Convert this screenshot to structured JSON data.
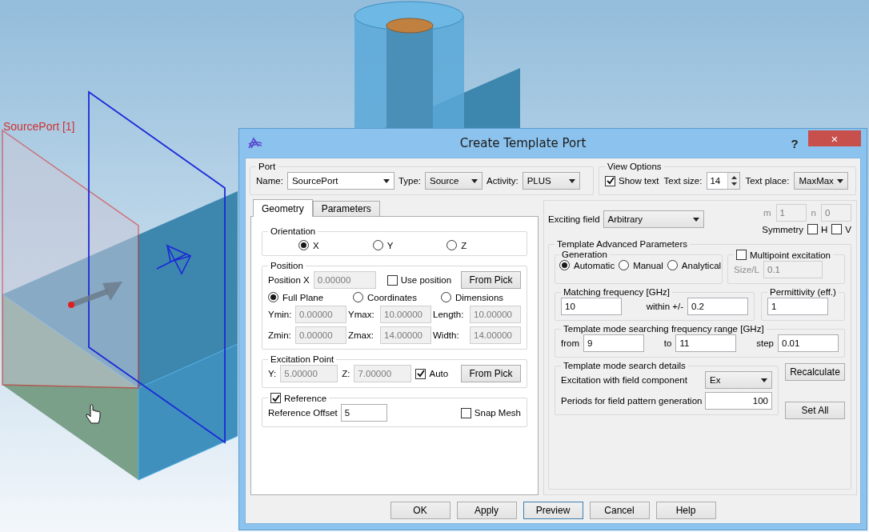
{
  "scene": {
    "port_label": "SourcePort [1]"
  },
  "dialog": {
    "title": "Create Template Port",
    "help": "?",
    "close": "×"
  },
  "port": {
    "title": "Port",
    "name_label": "Name:",
    "name": "SourcePort",
    "type_label": "Type:",
    "type": "Source",
    "activity_label": "Activity:",
    "activity": "PLUS"
  },
  "view_options": {
    "title": "View Options",
    "show_text": {
      "label": "Show text",
      "checked": true
    },
    "text_size_label": "Text size:",
    "text_size": "14",
    "text_place_label": "Text place:",
    "text_place": "MaxMax"
  },
  "tabs": [
    {
      "label": "Geometry",
      "selected": true
    },
    {
      "label": "Parameters",
      "selected": false
    }
  ],
  "orientation": {
    "title": "Orientation",
    "options": [
      {
        "label": "X",
        "selected": true
      },
      {
        "label": "Y",
        "selected": false
      },
      {
        "label": "Z",
        "selected": false
      }
    ]
  },
  "position": {
    "title": "Position",
    "position_x_label": "Position X",
    "position_x": {
      "value": "0.00000",
      "disabled": true
    },
    "use_position": {
      "label": "Use position",
      "checked": false
    },
    "from_pick": "From Pick",
    "modes": [
      {
        "label": "Full Plane",
        "selected": true
      },
      {
        "label": "Coordinates",
        "selected": false
      },
      {
        "label": "Dimensions",
        "selected": false
      }
    ],
    "fields": [
      {
        "label": "Ymin:",
        "value": "0.00000",
        "disabled": true
      },
      {
        "label": "Ymax:",
        "value": "10.00000",
        "disabled": true
      },
      {
        "label": "Length:",
        "value": "10.00000",
        "disabled": true
      },
      {
        "label": "Zmin:",
        "value": "0.00000",
        "disabled": true
      },
      {
        "label": "Zmax:",
        "value": "14.00000",
        "disabled": true
      },
      {
        "label": "Width:",
        "value": "14.00000",
        "disabled": true
      }
    ]
  },
  "excitation_point": {
    "title": "Excitation Point",
    "fields": [
      {
        "label": "Y:",
        "value": "5.00000",
        "disabled": true
      },
      {
        "label": "Z:",
        "value": "7.00000",
        "disabled": true
      }
    ],
    "auto": {
      "label": "Auto",
      "checked": true
    },
    "from_pick": "From Pick"
  },
  "reference": {
    "label": "Reference",
    "checked": true,
    "offset_label": "Reference Offset",
    "offset": {
      "value": "5",
      "disabled": false
    },
    "snap_mesh": {
      "label": "Snap Mesh",
      "checked": false
    }
  },
  "exciting_field": {
    "label": "Exciting field",
    "value": "Arbitrary",
    "m_label": "m",
    "m": {
      "value": "1",
      "disabled": true
    },
    "n_label": "n",
    "n": {
      "value": "0",
      "disabled": true
    },
    "symmetry_label": "Symmetry",
    "symmetry": [
      {
        "label": "H",
        "checked": false
      },
      {
        "label": "V",
        "checked": false
      }
    ]
  },
  "advanced": {
    "title": "Template Advanced Parameters",
    "generation": {
      "title": "Generation",
      "options": [
        {
          "label": "Automatic",
          "selected": true
        },
        {
          "label": "Manual",
          "selected": false
        },
        {
          "label": "Analytical",
          "selected": false
        }
      ]
    },
    "multipoint": {
      "label": "Multipoint excitation",
      "checked": false,
      "size_label": "Size/L",
      "size": {
        "value": "0.1",
        "disabled": true
      }
    },
    "matching": {
      "title": "Matching frequency [GHz]",
      "value": {
        "value": "10",
        "disabled": false
      },
      "within_label": "within +/-",
      "within": {
        "value": "0.2",
        "disabled": false
      }
    },
    "permittivity": {
      "title": "Permittivity (eff.)",
      "value": {
        "value": "1",
        "disabled": false
      }
    },
    "range": {
      "title": "Template mode searching frequency range [GHz]",
      "fields": [
        {
          "label": "from",
          "value": "9",
          "disabled": false
        },
        {
          "label": "to",
          "value": "11",
          "disabled": false
        },
        {
          "label": "step",
          "value": "0.01",
          "disabled": false
        }
      ]
    },
    "details": {
      "title": "Template mode search details",
      "component_label": "Excitation with field component",
      "component": "Ex",
      "periods_label": "Periods for field pattern generation",
      "periods": {
        "value": "100",
        "disabled": false
      }
    },
    "recalculate": "Recalculate",
    "set_all": "Set All"
  },
  "buttons": [
    {
      "label": "OK",
      "focused": false
    },
    {
      "label": "Apply",
      "focused": false
    },
    {
      "label": "Preview",
      "focused": true
    },
    {
      "label": "Cancel",
      "focused": false
    },
    {
      "label": "Help",
      "focused": false
    }
  ]
}
